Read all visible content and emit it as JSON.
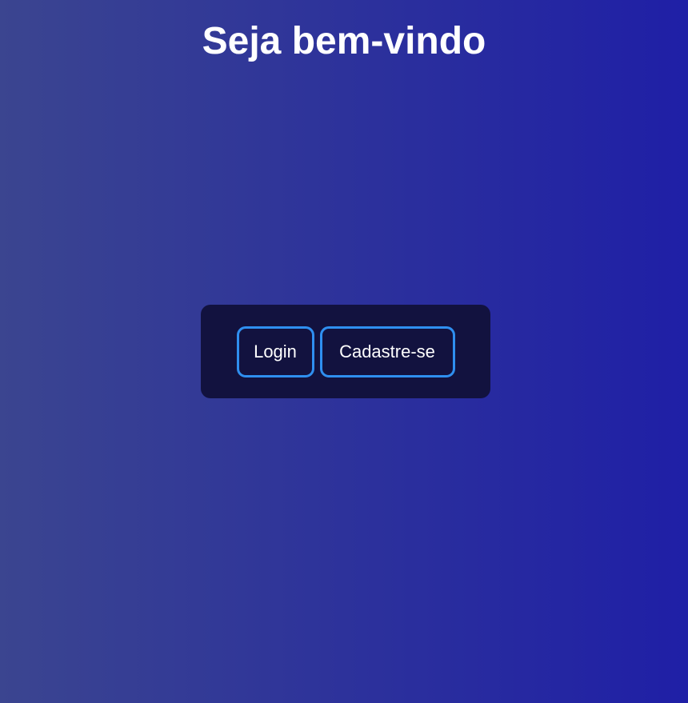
{
  "header": {
    "title": "Seja bem-vindo"
  },
  "auth": {
    "login_label": "Login",
    "signup_label": "Cadastre-se"
  },
  "colors": {
    "background_left": "#3b4590",
    "background_right": "#1f1fa6",
    "panel": "#12123f",
    "button_border": "#2f8ff0",
    "text": "#ffffff"
  }
}
